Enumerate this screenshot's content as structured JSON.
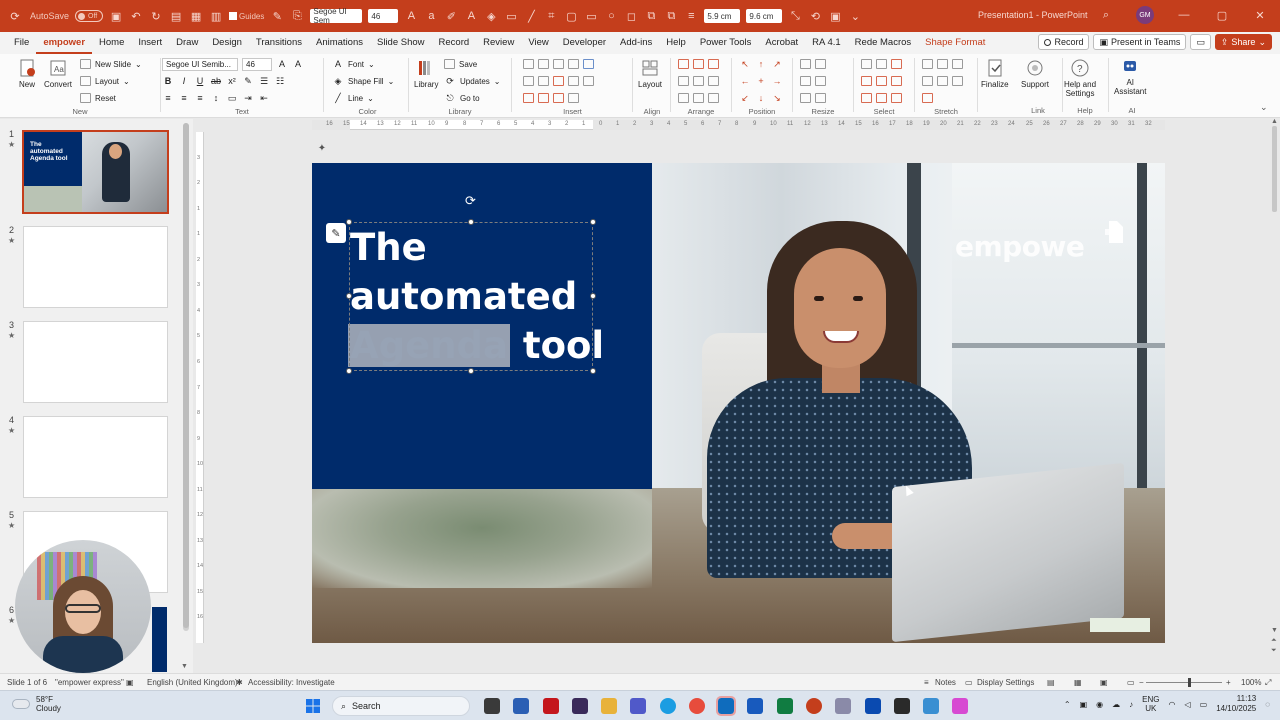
{
  "titlebar": {
    "autosave_label": "AutoSave",
    "autosave_state": "Off",
    "guides_label": "Guides",
    "font_name": "Segoe UI Sem",
    "font_size": "46",
    "width_value": "5.9 cm",
    "height_value": "9.6 cm",
    "doc_title": "Presentation1 - PowerPoint",
    "user_initials": "GM"
  },
  "tabs": [
    "File",
    "empower",
    "Home",
    "Insert",
    "Draw",
    "Design",
    "Transitions",
    "Animations",
    "Slide Show",
    "Record",
    "Review",
    "View",
    "Developer",
    "Add-ins",
    "Help",
    "Power Tools",
    "Acrobat",
    "RA 4.1",
    "Rede Macros",
    "Shape Format"
  ],
  "tab_actions": {
    "record": "Record",
    "present": "Present in Teams",
    "share": "Share"
  },
  "ribbon": {
    "new_btn": "New",
    "convert_btn": "Convert",
    "new_slide": "New Slide",
    "layout": "Layout",
    "reset": "Reset",
    "group_new": "New",
    "font_box": "Segoe UI Semib...",
    "size_box": "46",
    "group_text": "Text",
    "font": "Font",
    "shape_fill": "Shape Fill",
    "line": "Line",
    "group_color": "Color",
    "library_btn": "Library",
    "save": "Save",
    "updates": "Updates",
    "go_to": "Go to",
    "group_library": "Library",
    "group_insert": "Insert",
    "layout_btn": "Layout",
    "group_align": "Align",
    "group_arrange": "Arrange",
    "group_position": "Position",
    "group_resize": "Resize",
    "group_select": "Select",
    "group_stretch": "Stretch",
    "finalize": "Finalize",
    "support": "Support",
    "group_link": "Link",
    "help_settings_1": "Help and",
    "help_settings_2": "Settings",
    "group_help": "Help",
    "ai_1": "AI",
    "ai_2": "Assistant",
    "group_ai": "AI"
  },
  "slides": [
    {
      "num": "1",
      "title_lines": [
        "The",
        "automated",
        "Agenda tool"
      ]
    },
    {
      "num": "2"
    },
    {
      "num": "3"
    },
    {
      "num": "4"
    },
    {
      "num": "5"
    },
    {
      "num": "6"
    }
  ],
  "slide": {
    "title_line1": "The",
    "title_line2": "automated",
    "title_line3_highlight": "Agenda",
    "title_line3_rest": " tool",
    "logo_text": "empowe"
  },
  "ruler_h": [
    "16",
    "15",
    "14",
    "13",
    "12",
    "11",
    "10",
    "9",
    "8",
    "7",
    "6",
    "5",
    "4",
    "3",
    "2",
    "1",
    "0",
    "1",
    "2",
    "3",
    "4",
    "5",
    "6",
    "7",
    "8",
    "9",
    "10",
    "11",
    "12",
    "13",
    "14",
    "15",
    "16",
    "17",
    "18",
    "19",
    "20",
    "21",
    "22",
    "23",
    "24",
    "25",
    "26",
    "27",
    "28",
    "29",
    "30",
    "31",
    "32"
  ],
  "ruler_v": [
    "3",
    "2",
    "1",
    "1",
    "2",
    "3",
    "4",
    "5",
    "6",
    "7",
    "8",
    "9",
    "10",
    "11",
    "12",
    "13",
    "14",
    "15",
    "16"
  ],
  "statusbar": {
    "slide_of": "Slide 1 of 6",
    "theme": "\"empower express\"",
    "language": "English (United Kingdom)",
    "accessibility": "Accessibility: Investigate",
    "notes": "Notes",
    "display": "Display Settings",
    "zoom": "100%"
  },
  "taskbar": {
    "temp": "58°F",
    "weather": "Cloudy",
    "search": "Search",
    "lang1": "ENG",
    "lang2": "UK",
    "time": "11:13",
    "date": "14/10/2025"
  },
  "colors": {
    "accent": "#c43e1c",
    "slide_blue": "#002b6b"
  }
}
